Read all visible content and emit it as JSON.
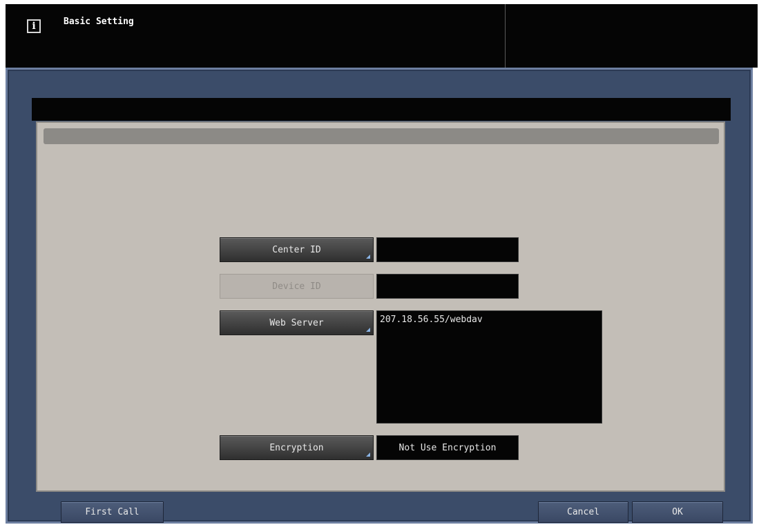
{
  "header": {
    "title": "Basic Setting",
    "info_icon": "i"
  },
  "form": {
    "center_id": {
      "label": "Center ID",
      "value": ""
    },
    "device_id": {
      "label": "Device ID",
      "value": ""
    },
    "web_server": {
      "label": "Web Server",
      "value": "207.18.56.55/webdav"
    },
    "encryption": {
      "label": "Encryption",
      "value": "Not Use Encryption"
    }
  },
  "footer": {
    "first_call_label": "First Call",
    "cancel_label": "Cancel",
    "ok_label": "OK"
  },
  "colors": {
    "frame_blue": "#3b4c69",
    "panel_gray": "#c3beb7",
    "field_black": "#050505",
    "corner_accent": "#8ab4e6"
  }
}
